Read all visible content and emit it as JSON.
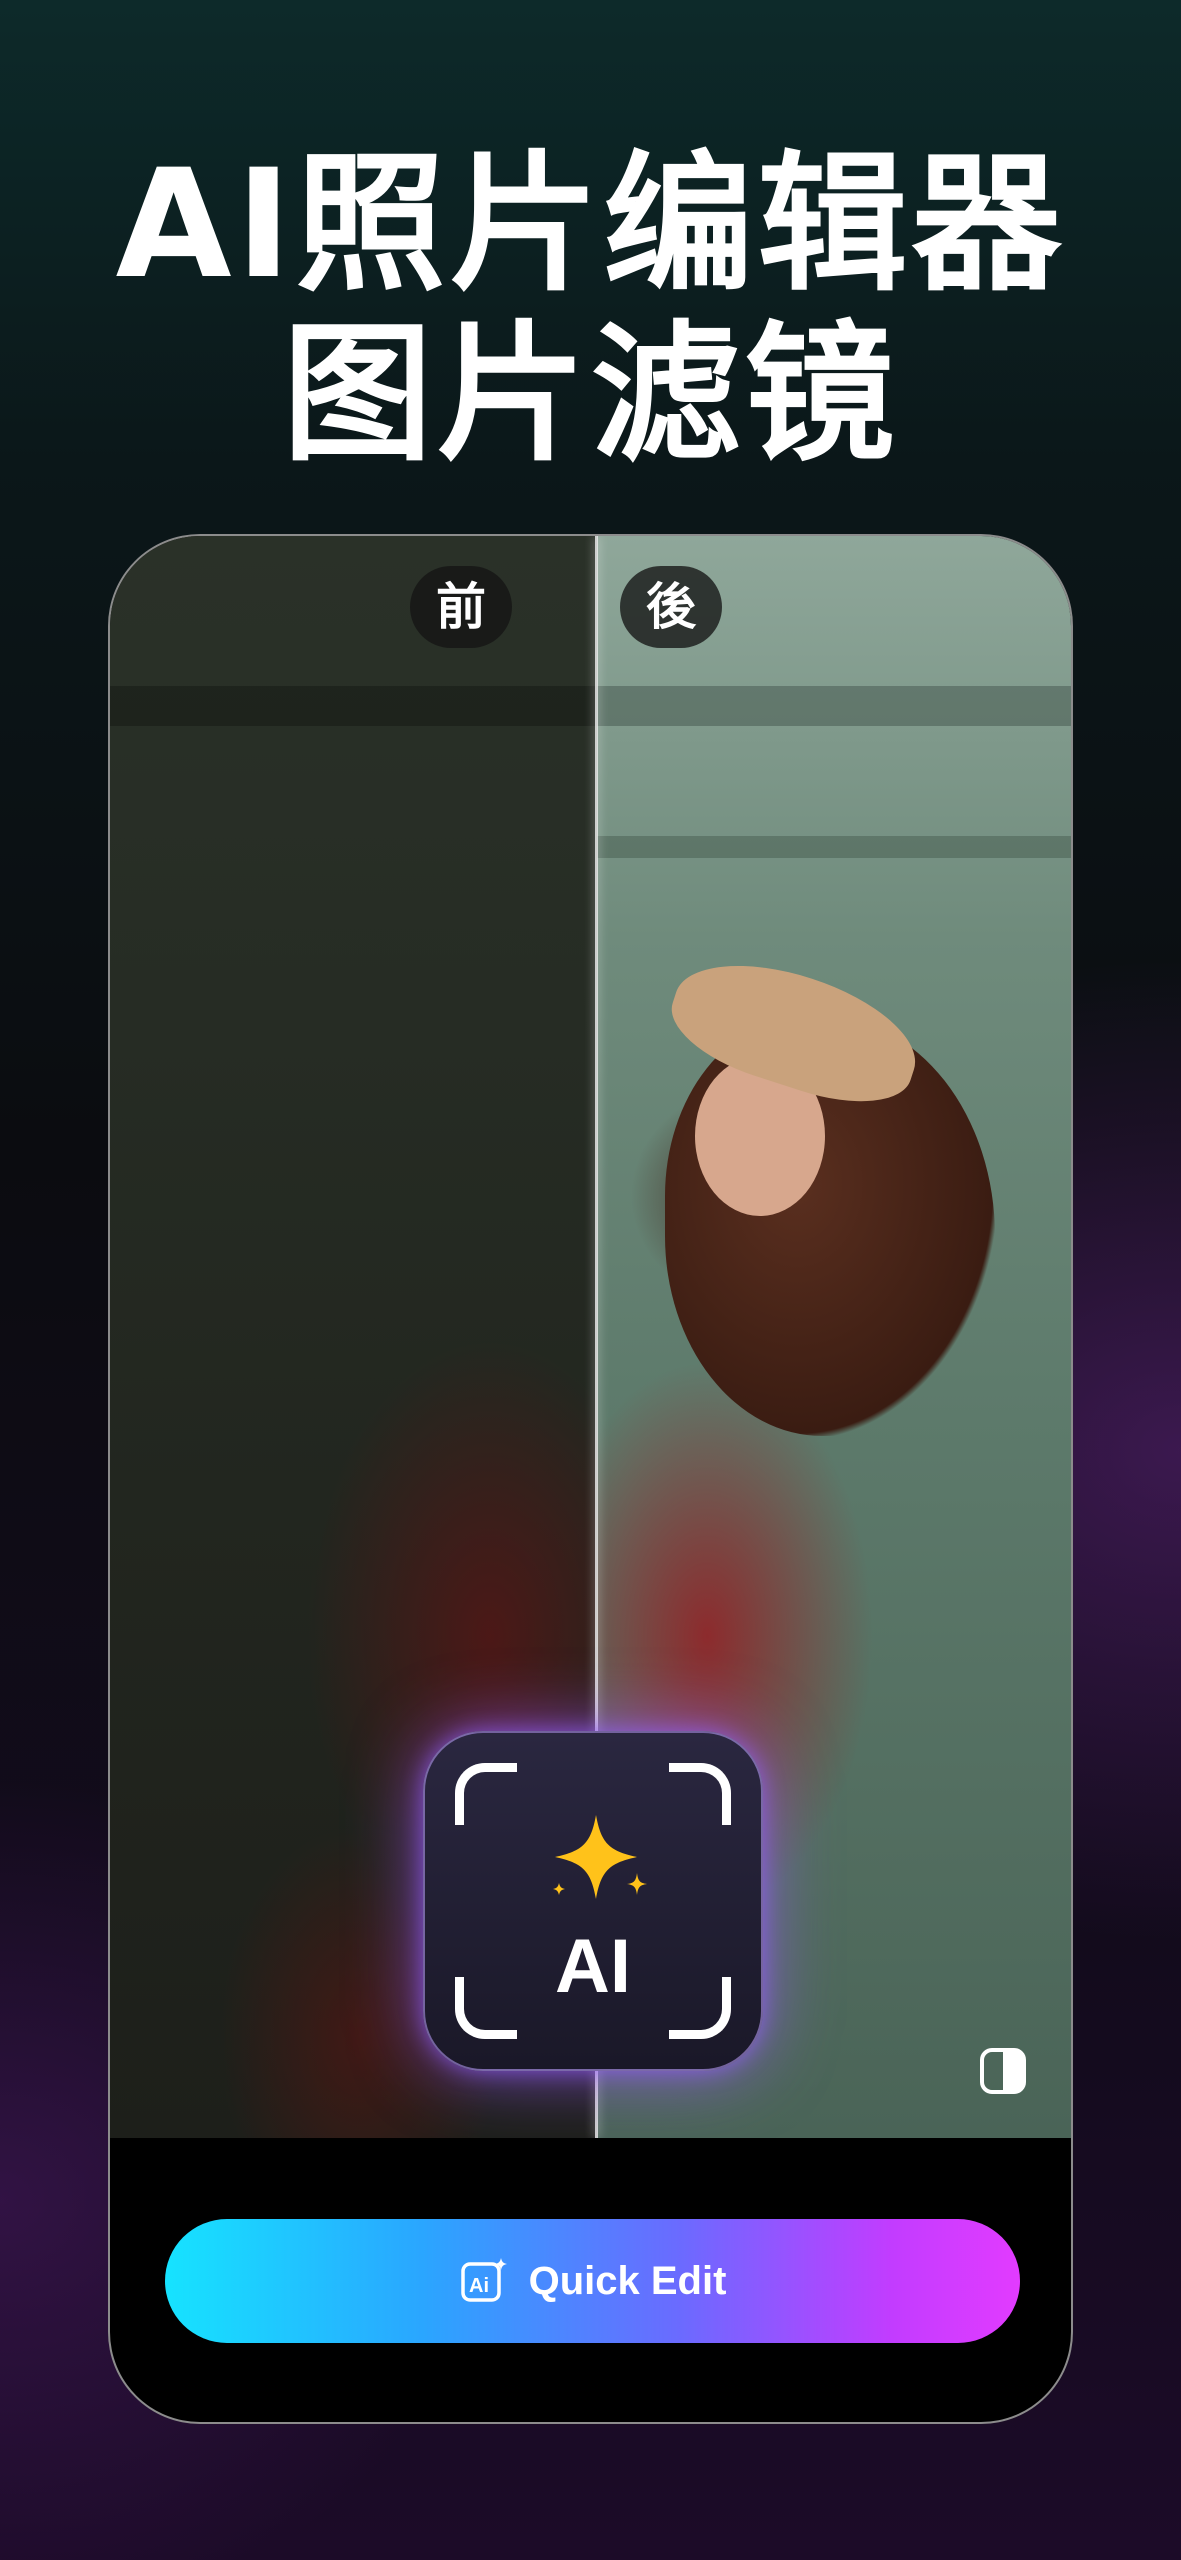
{
  "headline": {
    "line1": "AI照片编辑器",
    "line2": "图片滤镜"
  },
  "compare": {
    "before_label": "前",
    "after_label": "後"
  },
  "ai_badge": {
    "text": "AI",
    "icon": "sparkle-icon"
  },
  "compare_toggle": {
    "icon": "split-compare-icon"
  },
  "quick_edit": {
    "label": "Quick Edit",
    "icon": "ai-edit-icon"
  },
  "colors": {
    "button_gradient": [
      "#16e3ff",
      "#6a6bff",
      "#e23bff"
    ],
    "sparkle": "#ffc21a",
    "glow": "#a05aff"
  }
}
